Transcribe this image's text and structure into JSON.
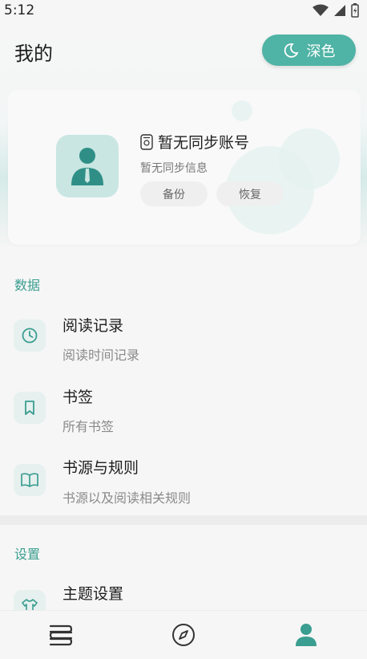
{
  "status_bar": {
    "time": "5:12"
  },
  "header": {
    "title": "我的",
    "theme_button_label": "深色"
  },
  "account_card": {
    "title": "暂无同步账号",
    "subtitle": "暂无同步信息",
    "backup_label": "备份",
    "restore_label": "恢复"
  },
  "sections": {
    "data_label": "数据",
    "settings_label": "设置"
  },
  "data_items": [
    {
      "title": "阅读记录",
      "subtitle": "阅读时间记录",
      "icon": "clock-icon"
    },
    {
      "title": "书签",
      "subtitle": "所有书签",
      "icon": "bookmark-icon"
    },
    {
      "title": "书源与规则",
      "subtitle": "书源以及阅读相关规则",
      "icon": "book-open-icon"
    }
  ],
  "settings_items": [
    {
      "title": "主题设置",
      "icon": "shirt-icon"
    }
  ],
  "bottom_nav": [
    {
      "name": "bookshelf",
      "icon": "books-icon",
      "active": false
    },
    {
      "name": "explore",
      "icon": "compass-icon",
      "active": false
    },
    {
      "name": "profile",
      "icon": "person-icon",
      "active": true
    }
  ],
  "colors": {
    "accent": "#4fb3a5",
    "section": "#3a9e90"
  }
}
